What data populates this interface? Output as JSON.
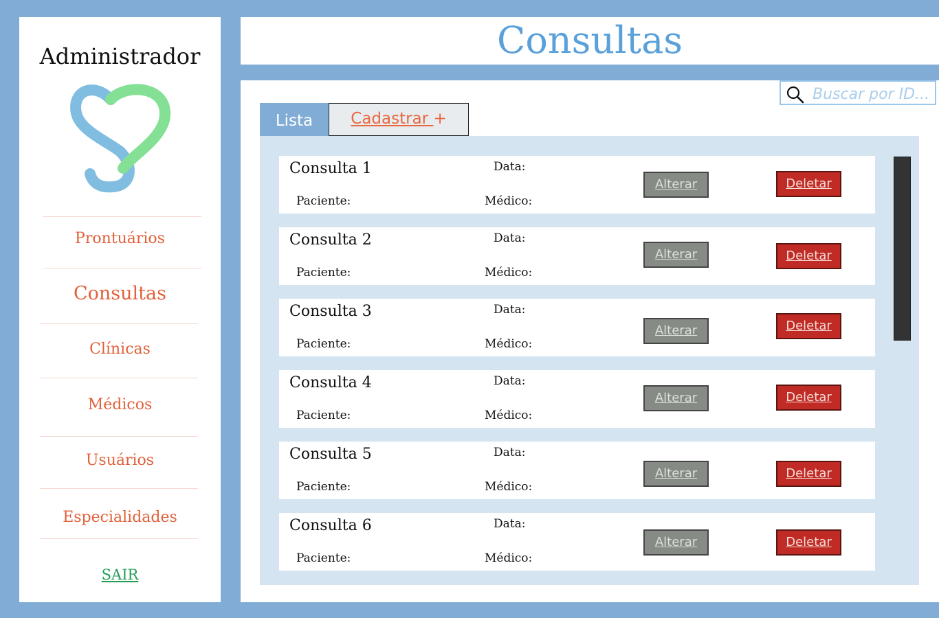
{
  "sidebar": {
    "title": "Administrador",
    "logo_icon": "heart-s-logo",
    "items": [
      {
        "label": "Prontuários"
      },
      {
        "label": "Consultas"
      },
      {
        "label": "Clínicas"
      },
      {
        "label": "Médicos"
      },
      {
        "label": "Usuários"
      },
      {
        "label": "Especialidades"
      }
    ],
    "logout_label": "SAIR"
  },
  "header": {
    "title": "Consultas"
  },
  "search": {
    "placeholder": "Buscar por ID..."
  },
  "tabs": {
    "list_label": "Lista",
    "create_label": "Cadastrar ",
    "create_plus": "+"
  },
  "consultas": [
    {
      "title": "Consulta 1",
      "data_label": "Data:",
      "paciente_label": "Paciente:",
      "medico_label": "Médico:",
      "alterar": "Alterar",
      "deletar": "Deletar"
    },
    {
      "title": "Consulta 2",
      "data_label": "Data:",
      "paciente_label": "Paciente:",
      "medico_label": "Médico:",
      "alterar": "Alterar",
      "deletar": "Deletar"
    },
    {
      "title": "Consulta 3",
      "data_label": "Data:",
      "paciente_label": "Paciente:",
      "medico_label": "Médico:",
      "alterar": "Alterar",
      "deletar": "Deletar"
    },
    {
      "title": "Consulta 4",
      "data_label": "Data:",
      "paciente_label": "Paciente:",
      "medico_label": "Médico:",
      "alterar": "Alterar",
      "deletar": "Deletar"
    },
    {
      "title": "Consulta 5",
      "data_label": "Data:",
      "paciente_label": "Paciente:",
      "medico_label": "Médico:",
      "alterar": "Alterar",
      "deletar": "Deletar"
    },
    {
      "title": "Consulta 6",
      "data_label": "Data:",
      "paciente_label": "Paciente:",
      "medico_label": "Médico:",
      "alterar": "Alterar",
      "deletar": "Deletar"
    }
  ],
  "colors": {
    "frame": "#81acd6",
    "title": "#5aa0da",
    "nav": "#e2603a",
    "logout": "#1f9d55",
    "alterar": "#868b85",
    "deletar": "#c02c25",
    "panel": "#d4e4f1"
  }
}
